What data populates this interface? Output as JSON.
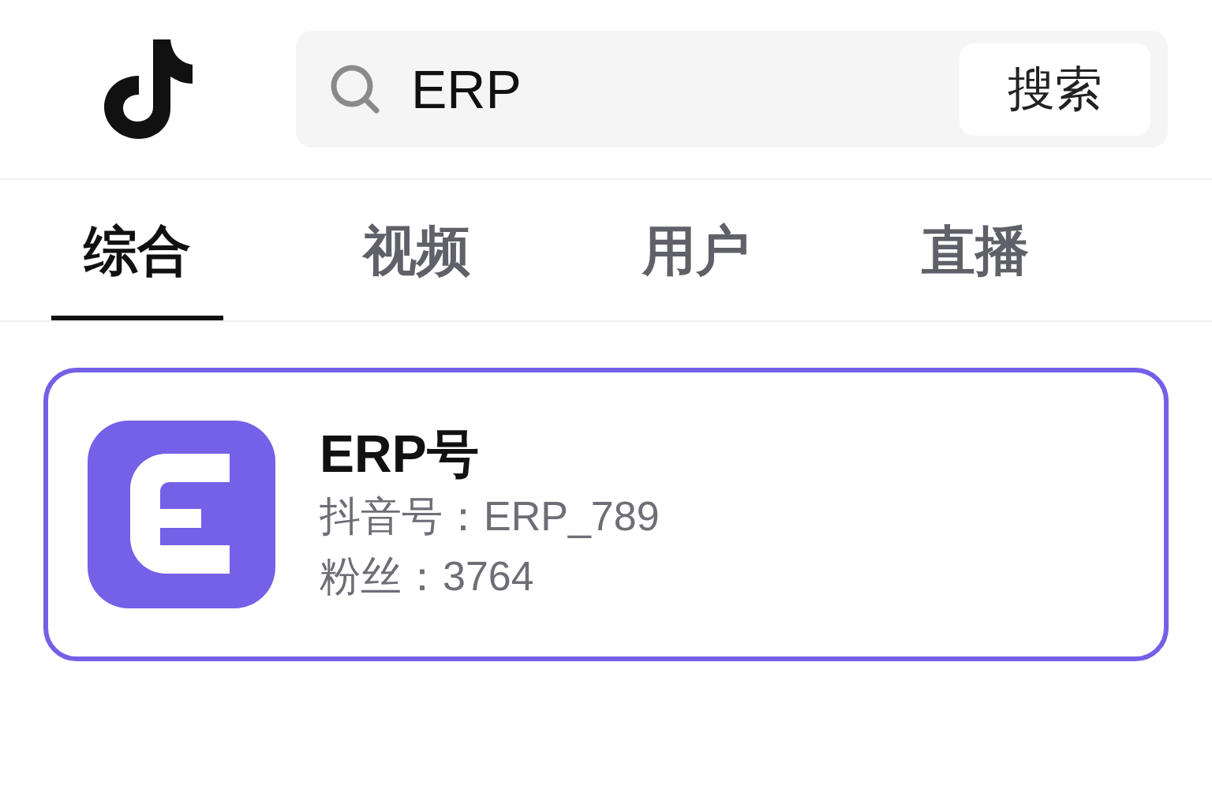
{
  "search": {
    "value": "ERP",
    "button": "搜索"
  },
  "tabs": [
    {
      "label": "综合",
      "selected": true
    },
    {
      "label": "视频",
      "selected": false
    },
    {
      "label": "用户",
      "selected": false
    },
    {
      "label": "直播",
      "selected": false
    }
  ],
  "results": [
    {
      "name": "ERP号",
      "handle_line": "抖音号：ERP_789",
      "followers_line": "粉丝：3764"
    }
  ]
}
